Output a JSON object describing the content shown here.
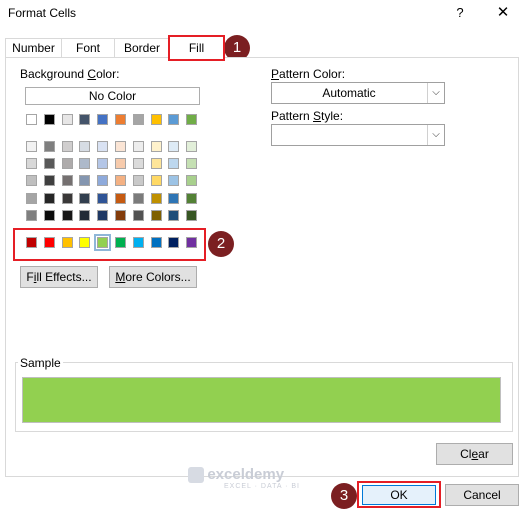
{
  "window": {
    "title": "Format Cells",
    "help_label": "?",
    "close_label": "✕"
  },
  "tabs": [
    {
      "label": "Number"
    },
    {
      "label": "Font"
    },
    {
      "label": "Border"
    },
    {
      "label": "Fill",
      "active": true
    }
  ],
  "fill": {
    "background_color_label": "Background Color:",
    "no_color_label": "No Color",
    "pattern_color_label": "Pattern Color:",
    "pattern_color_value": "Automatic",
    "pattern_style_label": "Pattern Style:",
    "pattern_style_value": "",
    "fill_effects_label": "Fill Effects...",
    "more_colors_label": "More Colors...",
    "selected_color": "#92d050"
  },
  "theme_colors_row": [
    "#ffffff",
    "#000000",
    "#e7e6e6",
    "#44546a",
    "#4472c4",
    "#ed7d31",
    "#a5a5a5",
    "#ffc000",
    "#5b9bd5",
    "#70ad47"
  ],
  "shade_rows": [
    [
      "#f2f2f2",
      "#7f7f7f",
      "#d0cece",
      "#d6dce4",
      "#d9e2f3",
      "#fbe5d5",
      "#ededed",
      "#fff2cc",
      "#deebf6",
      "#e2efd9"
    ],
    [
      "#d8d8d8",
      "#595959",
      "#aeabab",
      "#adb9ca",
      "#b4c6e7",
      "#f7cbac",
      "#dbdbdb",
      "#fee599",
      "#bdd7ee",
      "#c5e0b3"
    ],
    [
      "#bfbfbf",
      "#3f3f3f",
      "#757070",
      "#8496b0",
      "#8eaadb",
      "#f4b183",
      "#c9c9c9",
      "#ffd965",
      "#9cc3e5",
      "#a8d08d"
    ],
    [
      "#a5a5a5",
      "#262626",
      "#3a3838",
      "#323f4f",
      "#2f5496",
      "#c55a11",
      "#7b7b7b",
      "#bf9000",
      "#2e75b5",
      "#538135"
    ],
    [
      "#7f7f7f",
      "#0c0c0c",
      "#171616",
      "#222a35",
      "#1f3864",
      "#833c0b",
      "#525252",
      "#7f6000",
      "#1e4e79",
      "#375623"
    ]
  ],
  "standard_colors": [
    "#c00000",
    "#ff0000",
    "#ffc000",
    "#ffff00",
    "#92d050",
    "#00b050",
    "#00b0f0",
    "#0070c0",
    "#002060",
    "#7030a0"
  ],
  "sample": {
    "label": "Sample",
    "color": "#92d050"
  },
  "buttons": {
    "clear_label": "Clear",
    "ok_label": "OK",
    "cancel_label": "Cancel"
  },
  "badges": {
    "b1": "1",
    "b2": "2",
    "b3": "3"
  },
  "watermark": {
    "brand": "exceldemy",
    "tagline": "EXCEL · DATA · BI"
  }
}
